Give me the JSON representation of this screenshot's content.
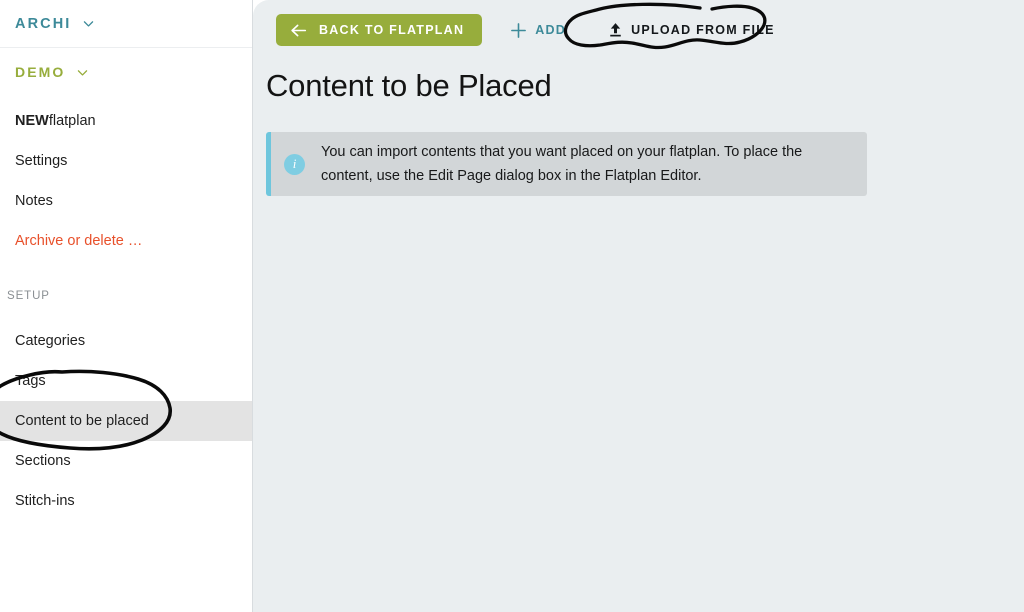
{
  "sidebar": {
    "org": {
      "label": "ARCHI",
      "icon": "chevron-down-icon"
    },
    "project": {
      "label": "DEMO",
      "icon": "chevron-down-icon"
    },
    "nav_items": [
      {
        "label_strong": "NEW",
        "label_rest": " flatplan"
      },
      {
        "label": "Settings"
      },
      {
        "label": "Notes"
      },
      {
        "label": "Archive or delete …"
      }
    ],
    "setup_heading": "SETUP",
    "setup_items": [
      {
        "label": "Categories",
        "active": false
      },
      {
        "label": "Tags",
        "active": false
      },
      {
        "label": "Content to be placed",
        "active": true
      },
      {
        "label": "Sections",
        "active": false
      },
      {
        "label": "Stitch-ins",
        "active": false
      }
    ]
  },
  "toolbar": {
    "back_label": "BACK TO FLATPLAN",
    "back_icon": "arrow-left-icon",
    "add_label": "ADD",
    "add_icon": "plus-icon",
    "upload_label": "UPLOAD FROM FILE",
    "upload_icon": "upload-icon"
  },
  "main": {
    "title": "Content to be Placed",
    "notice": {
      "icon": "info-icon",
      "icon_glyph": "i",
      "text": "You can import contents that you want placed on your flatplan. To place the content, use the Edit Page dialog box in the Flatplan Editor."
    }
  },
  "annotations": [
    {
      "name": "circle-upload-from-file",
      "target": "UPLOAD FROM FILE"
    },
    {
      "name": "circle-content-to-be-placed",
      "target": "Content to be placed"
    }
  ],
  "colors": {
    "brand_green": "#97ad3c",
    "brand_teal": "#3d8a99",
    "danger_orange": "#e8502a",
    "info_blue": "#6ec6dd",
    "main_bg": "#eaeef0",
    "notice_bg": "#d2d6d8",
    "active_row": "#e3e3e3"
  }
}
